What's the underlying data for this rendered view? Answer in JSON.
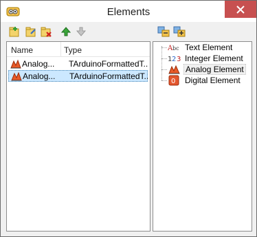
{
  "window": {
    "title": "Elements",
    "accent_close": "#c75050"
  },
  "toolbar": {
    "buttons": [
      "add-element-icon",
      "edit-element-icon",
      "delete-element-icon",
      "move-up-icon",
      "move-down-icon"
    ]
  },
  "list": {
    "columns": [
      "Name",
      "Type"
    ],
    "rows": [
      {
        "name": "Analog...",
        "type": "TArduinoFormattedT...",
        "selected": false
      },
      {
        "name": "Analog...",
        "type": "TArduinoFormattedT...",
        "selected": true
      }
    ]
  },
  "palette": {
    "toolbar_buttons": [
      "expand-all-icon",
      "collapse-all-icon"
    ],
    "items": [
      {
        "label": "Text Element",
        "icon": "text-element-icon"
      },
      {
        "label": "Integer Element",
        "icon": "integer-element-icon"
      },
      {
        "label": "Analog Element",
        "icon": "analog-element-icon",
        "selected": true
      },
      {
        "label": "Digital Element",
        "icon": "digital-element-icon"
      }
    ]
  }
}
